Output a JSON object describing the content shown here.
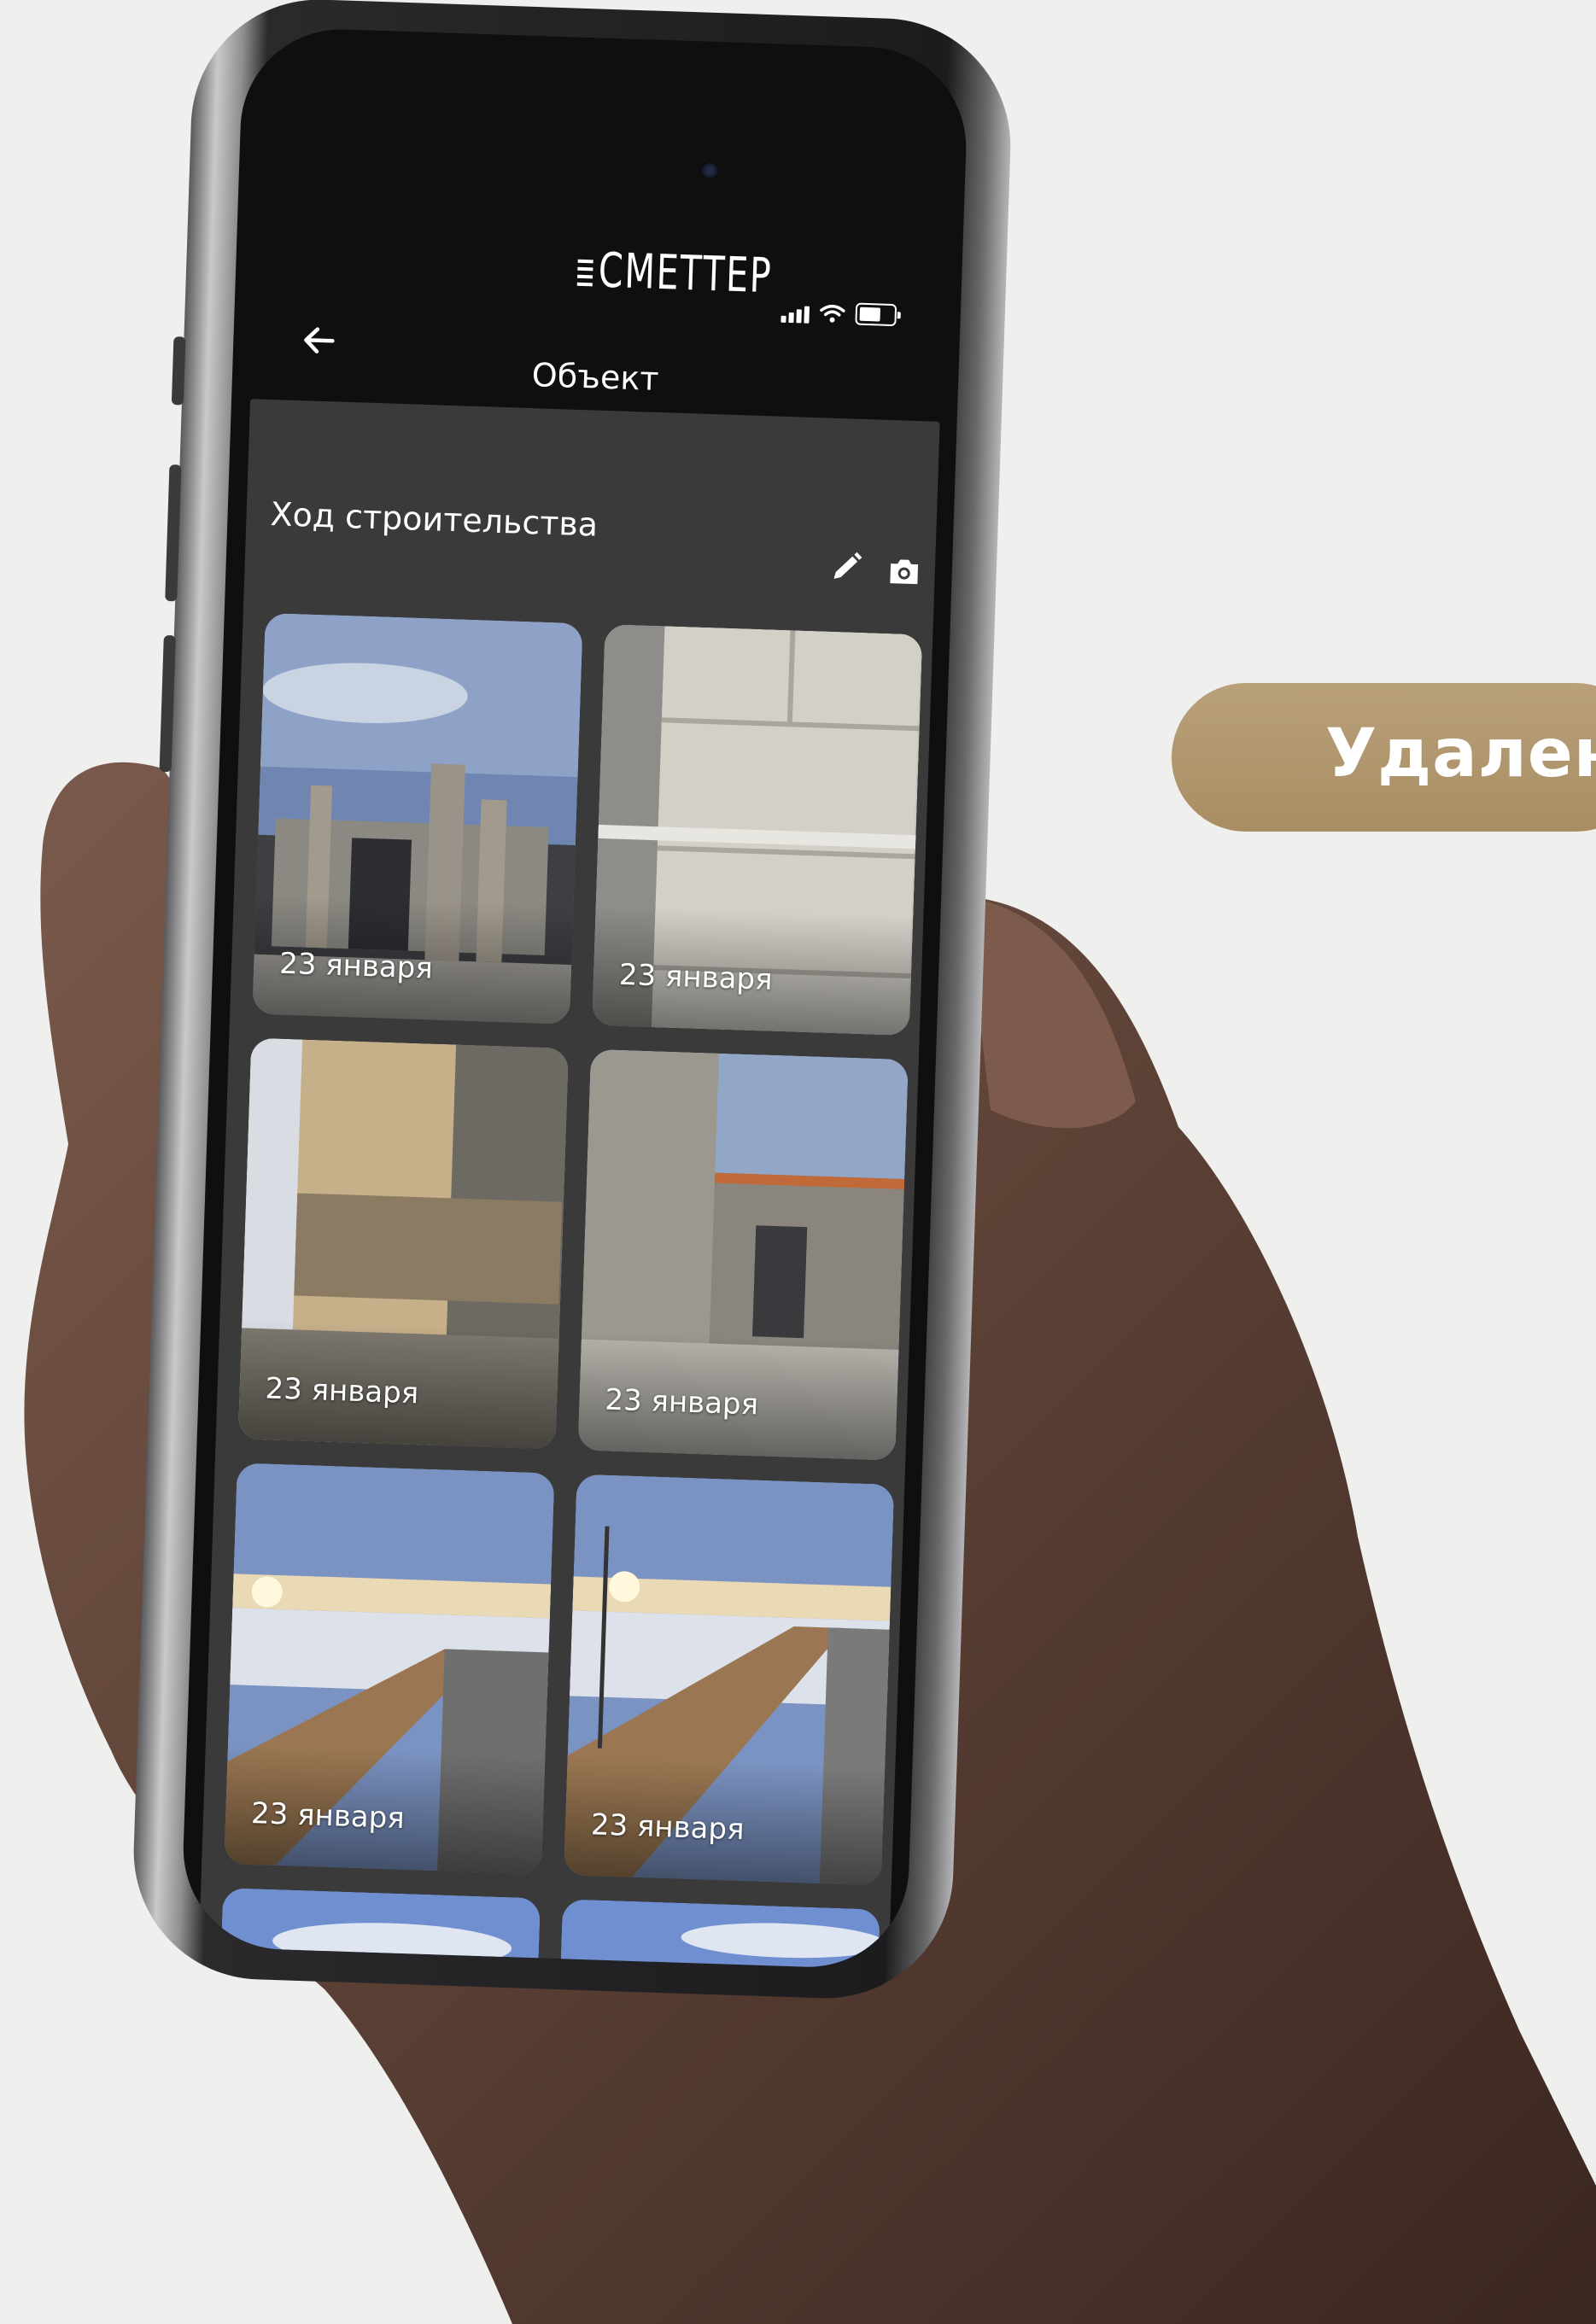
{
  "badge": {
    "label": "Удален"
  },
  "app": {
    "logo": "СМЕТТЕР",
    "back_icon": "arrow-left-icon",
    "title": "Объект"
  },
  "section": {
    "title": "Ход строительства",
    "actions": [
      "edit-icon",
      "camera-icon"
    ]
  },
  "photos": [
    {
      "date": "23 января"
    },
    {
      "date": "23 января"
    },
    {
      "date": "23 января"
    },
    {
      "date": "23 января"
    },
    {
      "date": "23 января"
    },
    {
      "date": "23 января"
    }
  ],
  "colors": {
    "background": "#efefee",
    "badge": "#a98e63",
    "screen": "#0f0f10",
    "panel": "#3a3a3b"
  }
}
